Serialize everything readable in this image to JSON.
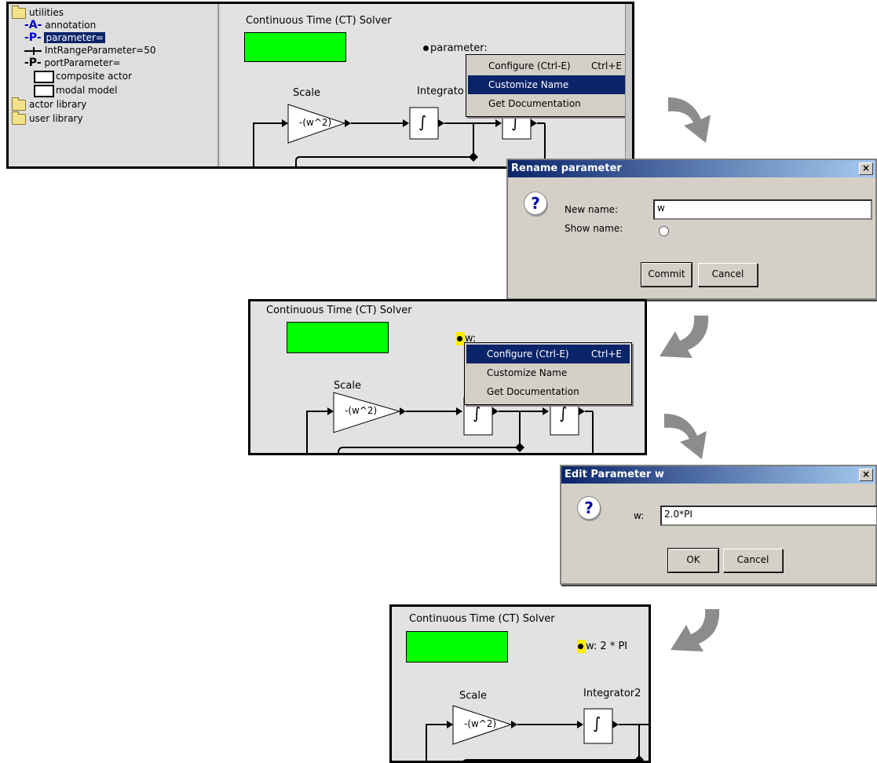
{
  "library_tree": {
    "items": [
      {
        "label": "utilities",
        "icon": "folder-icon"
      },
      {
        "tag": "-A-",
        "label": "annotation",
        "icon": "annotation-icon"
      },
      {
        "tag": "-P-",
        "label": "parameter=",
        "icon": "parameter-icon",
        "selected": true
      },
      {
        "label": "IntRangeParameter=50",
        "icon": "int-range-parameter-icon"
      },
      {
        "tag": "-P-",
        "label": "portParameter=",
        "icon": "port-parameter-icon"
      },
      {
        "label": "composite actor",
        "icon": "composite-actor-icon"
      },
      {
        "label": "modal model",
        "icon": "modal-model-icon"
      },
      {
        "label": "actor library",
        "icon": "folder-icon"
      },
      {
        "label": "user library",
        "icon": "folder-icon"
      }
    ]
  },
  "canvas1": {
    "director": "Continuous Time (CT) Solver",
    "param_label": "parameter:",
    "scale_label": "Scale",
    "scale_expr": "-(w^2)",
    "integrator_label": "Integrato",
    "integral_symbol": "∫",
    "menu": [
      {
        "label": "Configure (Ctrl-E)",
        "accel": "Ctrl+E",
        "active": false
      },
      {
        "label": "Customize Name",
        "accel": "",
        "active": true
      },
      {
        "label": "Get Documentation",
        "accel": "",
        "active": false
      }
    ]
  },
  "rename_dialog": {
    "title": "Rename parameter",
    "close": "×",
    "icon_glyph": "?",
    "new_name_label": "New name:",
    "new_name_value": "w",
    "show_name_label": "Show name:",
    "commit": "Commit",
    "cancel": "Cancel"
  },
  "canvas2": {
    "director": "Continuous Time (CT) Solver",
    "param_label": "w:",
    "scale_label": "Scale",
    "scale_expr": "-(w^2)",
    "integral_symbol": "∫",
    "menu": [
      {
        "label": "Configure (Ctrl-E)",
        "accel": "Ctrl+E",
        "active": true
      },
      {
        "label": "Customize Name",
        "accel": "",
        "active": false
      },
      {
        "label": "Get Documentation",
        "accel": "",
        "active": false
      }
    ]
  },
  "edit_dialog": {
    "title": "Edit Parameter w",
    "close": "×",
    "icon_glyph": "?",
    "w_label": "w:",
    "w_value": "2.0*PI",
    "ok": "OK",
    "cancel": "Cancel"
  },
  "canvas3": {
    "director": "Continuous Time (CT) Solver",
    "param_label": "w: 2 * PI",
    "scale_label": "Scale",
    "scale_expr": "-(w^2)",
    "integrator_label": "Integrator2",
    "integral_symbol": "∫"
  },
  "colors": {
    "director_green": "#00ff00",
    "menu_highlight": "#0a246a",
    "param_highlight": "#ffee00",
    "arrow_gray": "#8c8c8c"
  }
}
